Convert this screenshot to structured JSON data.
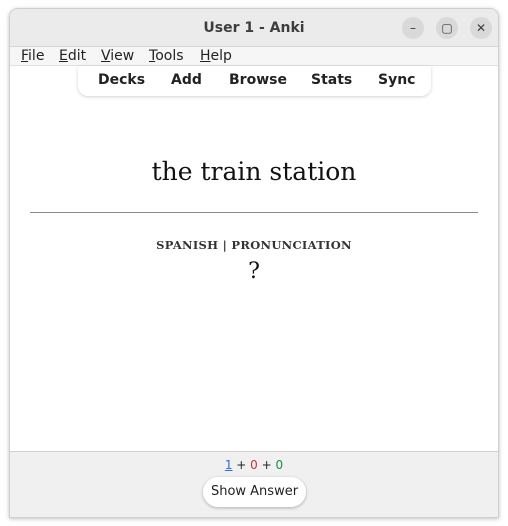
{
  "window": {
    "title": "User 1 - Anki",
    "controls": {
      "minimize": "–",
      "maximize": "▢",
      "close": "✕"
    }
  },
  "menubar": {
    "items": [
      {
        "first": "F",
        "rest": "ile"
      },
      {
        "first": "E",
        "rest": "dit"
      },
      {
        "first": "V",
        "rest": "iew"
      },
      {
        "first": "T",
        "rest": "ools"
      },
      {
        "first": "H",
        "rest": "elp"
      }
    ]
  },
  "toolbar": {
    "items": [
      "Decks",
      "Add",
      "Browse",
      "Stats",
      "Sync"
    ]
  },
  "card": {
    "front": "the train station",
    "label": "SPANISH | PRONUNCIATION",
    "answer": "?"
  },
  "counts": {
    "new": "1",
    "learning": "0",
    "review": "0",
    "separator": " + ",
    "colors": {
      "new": "#2a6fd6",
      "learning": "#c0392b",
      "review": "#1e8c3a"
    }
  },
  "bottom": {
    "show_answer": "Show Answer"
  }
}
